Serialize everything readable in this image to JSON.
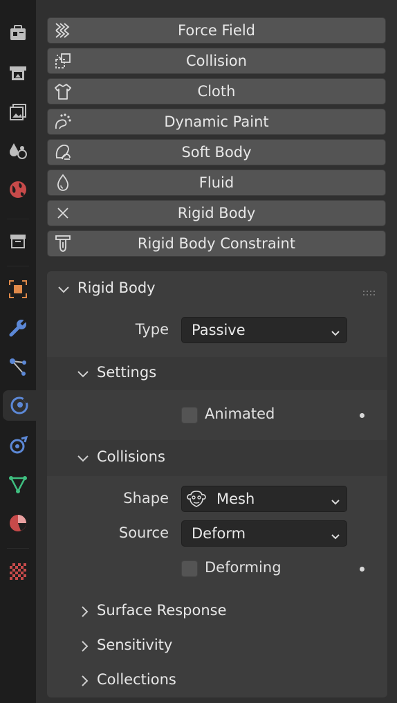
{
  "sidebar": {
    "tabs": [
      {
        "name": "tool-icon"
      },
      {
        "name": "render-icon"
      },
      {
        "name": "output-icon"
      },
      {
        "name": "view-layer-icon"
      },
      {
        "name": "scene-icon"
      },
      {
        "name": "world-icon"
      },
      {
        "name": "collection-icon"
      },
      {
        "name": "object-icon"
      },
      {
        "name": "modifier-wrench-icon"
      },
      {
        "name": "particles-icon"
      },
      {
        "name": "physics-icon",
        "active": true
      },
      {
        "name": "object-constraint-icon"
      },
      {
        "name": "object-data-icon"
      },
      {
        "name": "material-icon"
      },
      {
        "name": "texture-icon"
      }
    ]
  },
  "physics_buttons": [
    {
      "label": "Force Field",
      "icon": "force-field-icon"
    },
    {
      "label": "Collision",
      "icon": "collision-icon"
    },
    {
      "label": "Cloth",
      "icon": "cloth-icon"
    },
    {
      "label": "Dynamic Paint",
      "icon": "dynamic-paint-icon"
    },
    {
      "label": "Soft Body",
      "icon": "soft-body-icon"
    },
    {
      "label": "Fluid",
      "icon": "fluid-icon"
    },
    {
      "label": "Rigid Body",
      "icon": "remove-x-icon"
    },
    {
      "label": "Rigid Body Constraint",
      "icon": "rigid-body-constraint-icon"
    }
  ],
  "rigid_body": {
    "title": "Rigid Body",
    "type_label": "Type",
    "type_value": "Passive",
    "settings": {
      "title": "Settings",
      "animated_label": "Animated",
      "animated_checked": false
    },
    "collisions": {
      "title": "Collisions",
      "shape_label": "Shape",
      "shape_value": "Mesh",
      "source_label": "Source",
      "source_value": "Deform",
      "deforming_label": "Deforming",
      "deforming_checked": false
    },
    "collapsed_sections": [
      "Surface Response",
      "Sensitivity",
      "Collections"
    ]
  }
}
